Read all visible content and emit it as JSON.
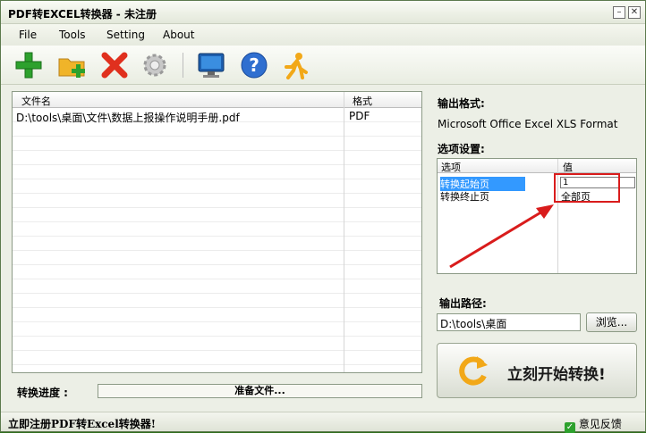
{
  "window": {
    "title": "PDF转EXCEL转换器 - 未注册"
  },
  "menu": [
    "File",
    "Tools",
    "Setting",
    "About"
  ],
  "toolbar": [
    "add-icon",
    "add-folder-icon",
    "delete-icon",
    "settings-icon",
    "monitor-icon",
    "help-icon",
    "runner-icon"
  ],
  "filelist": {
    "columns": [
      "文件名",
      "格式"
    ],
    "rows": [
      {
        "name": "D:\\tools\\桌面\\文件\\数据上报操作说明手册.pdf",
        "format": "PDF"
      }
    ]
  },
  "progress": {
    "label": "转换进度 :",
    "status": "准备文件..."
  },
  "output": {
    "format_label": "输出格式:",
    "format_value": "Microsoft Office Excel XLS Format",
    "options_label": "选项设置:",
    "options_columns": [
      "选项",
      "值"
    ],
    "options": [
      {
        "name": "转换起始页",
        "value": "1"
      },
      {
        "name": "转换终止页",
        "value": "全部页"
      }
    ],
    "path_label": "输出路径:",
    "path_value": "D:\\tools\\桌面",
    "browse_label": "浏览...",
    "start_label": "立刻开始转换!"
  },
  "status": {
    "register_link": "立即注册PDF转Excel转换器!",
    "feedback": "意见反馈"
  },
  "colors": {
    "highlight": "#d91c1c",
    "selection": "#3399ff"
  }
}
